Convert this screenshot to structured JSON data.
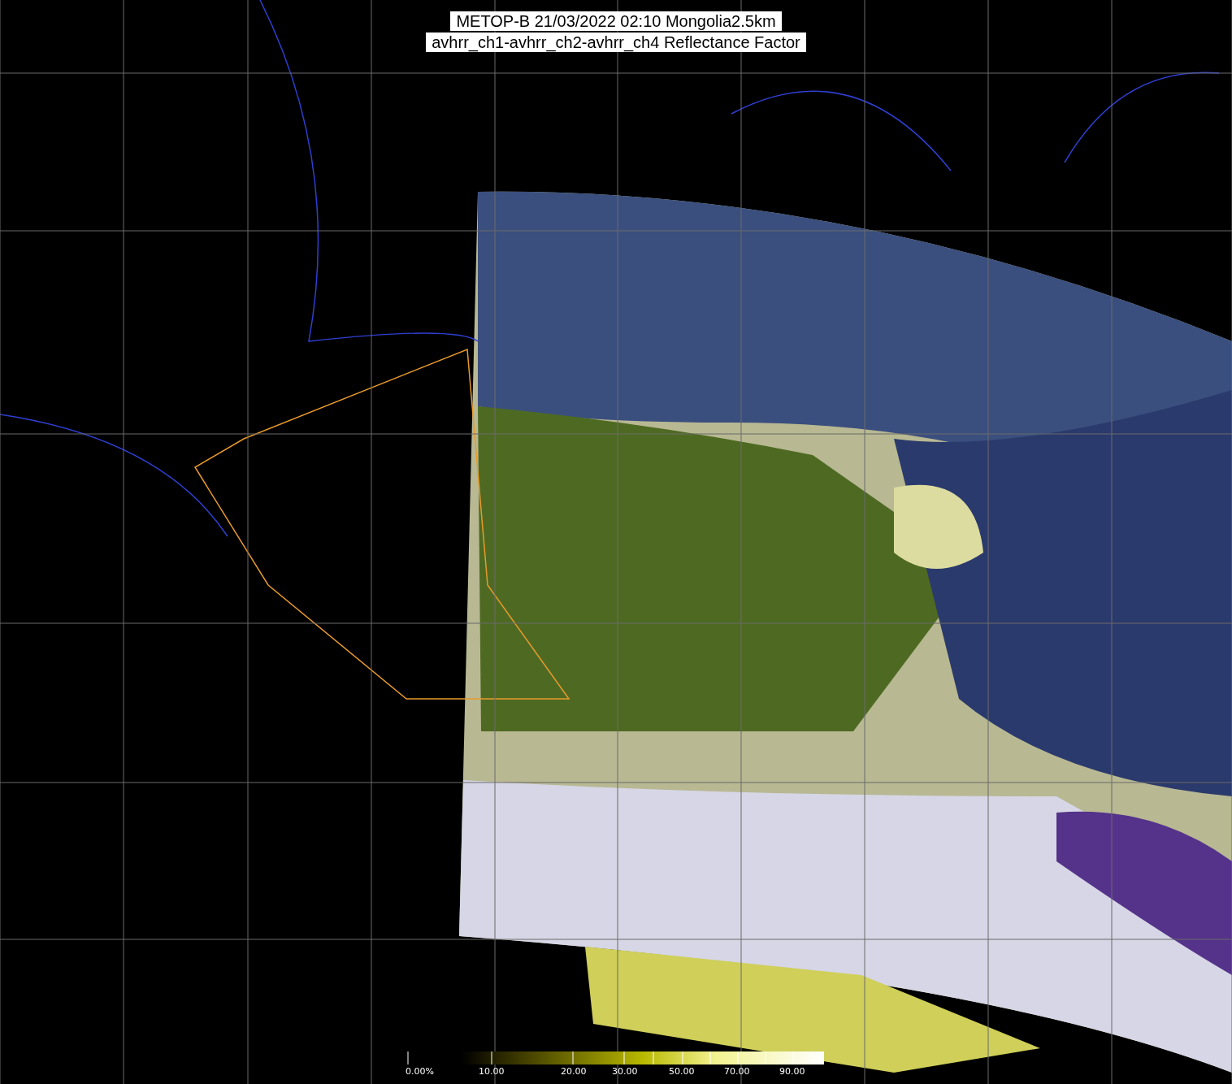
{
  "title_lines": [
    "METOP-B 21/03/2022 02:10 Mongolia2.5km",
    "avhrr_ch1-avhrr_ch2-avhrr_ch4 Reflectance Factor"
  ],
  "colorbar": {
    "labels": [
      "0.00%",
      "10.00",
      "20.00",
      "30.00",
      "50.00",
      "70.00",
      "90.00"
    ]
  }
}
